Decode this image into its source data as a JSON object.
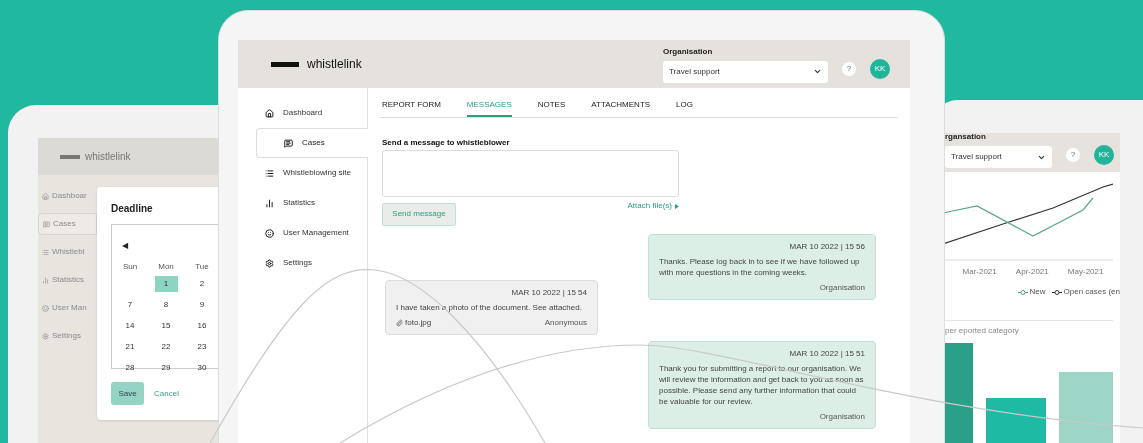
{
  "left_tablet": {
    "brand": "whistlelink",
    "sidebar": [
      {
        "label": "Dashboar",
        "selected": false
      },
      {
        "label": "Cases",
        "selected": true
      },
      {
        "label": "Whistlebl",
        "selected": false
      },
      {
        "label": "Statistics",
        "selected": false
      },
      {
        "label": "User Man",
        "selected": false
      },
      {
        "label": "Settings",
        "selected": false
      }
    ],
    "dialog": {
      "title": "Deadline",
      "prev": "◀",
      "weekdays": [
        "Sun",
        "Mon",
        "Tue"
      ],
      "weeks": [
        [
          {
            "day": "1",
            "selected": true
          },
          {
            "day": "2",
            "selected": false
          }
        ],
        [
          {
            "day": "7",
            "selected": false
          },
          {
            "day": "8",
            "selected": false
          },
          {
            "day": "9",
            "selected": false
          }
        ],
        [
          {
            "day": "14",
            "selected": false
          },
          {
            "day": "15",
            "selected": false
          },
          {
            "day": "16",
            "selected": false
          }
        ],
        [
          {
            "day": "21",
            "selected": false
          },
          {
            "day": "22",
            "selected": false
          },
          {
            "day": "23",
            "selected": false
          }
        ],
        [
          {
            "day": "28",
            "selected": false
          },
          {
            "day": "29",
            "selected": false
          },
          {
            "day": "30",
            "selected": false
          }
        ]
      ],
      "save": "Save",
      "cancel": "Cancel"
    }
  },
  "center_tablet": {
    "brand": "whistlelink",
    "organisation": {
      "label": "Organisation",
      "value": "Travel support"
    },
    "help": "?",
    "avatar": "KK",
    "sidebar": [
      {
        "label": "Dashboard",
        "selected": false
      },
      {
        "label": "Cases",
        "selected": true
      },
      {
        "label": "Whistleblowing site",
        "selected": false
      },
      {
        "label": "Statistics",
        "selected": false
      },
      {
        "label": "User Management",
        "selected": false
      },
      {
        "label": "Settings",
        "selected": false
      }
    ],
    "tabs": [
      {
        "label": "REPORT FORM",
        "selected": false
      },
      {
        "label": "MESSAGES",
        "selected": true
      },
      {
        "label": "NOTES",
        "selected": false
      },
      {
        "label": "ATTACHMENTS",
        "selected": false
      },
      {
        "label": "LOG",
        "selected": false
      }
    ],
    "form": {
      "label": "Send a message to whistleblower",
      "button": "Send message",
      "attach": "Attach file(s)"
    },
    "messages": [
      {
        "kind": "organisation",
        "time": "MAR 10 2022 | 15  56",
        "text": "Thanks. Please log back in to see if we have followed up with more questions in the coming weeks.",
        "sender": "Organisation"
      },
      {
        "kind": "whistleblower",
        "time": "MAR 10 2022 | 15  54",
        "text": "I have taken a photo of the document. See attached.",
        "attachment": "foto.jpg",
        "sender": "Anonymous"
      },
      {
        "kind": "organisation",
        "time": "MAR 10 2022 | 15  51",
        "text": "Thank you for submitting a report to our organisation. We will review the information and get back to you as soon as possible. Please send any further information that could be valuable for our review.",
        "sender": "Organisation"
      }
    ]
  },
  "right_tablet": {
    "organisation": {
      "label": "rgansation",
      "value": "Travel support"
    },
    "help": "?",
    "avatar": "KK",
    "line_chart": {
      "x_labels": [
        "Mar-2021",
        "Apr-2021",
        "May-2021"
      ],
      "legend": [
        {
          "label": "New",
          "color": "#4f9e86"
        },
        {
          "label": "Open cases (en",
          "color": "#333333"
        }
      ]
    },
    "bar_chart": {
      "title": "per eported category"
    }
  }
}
